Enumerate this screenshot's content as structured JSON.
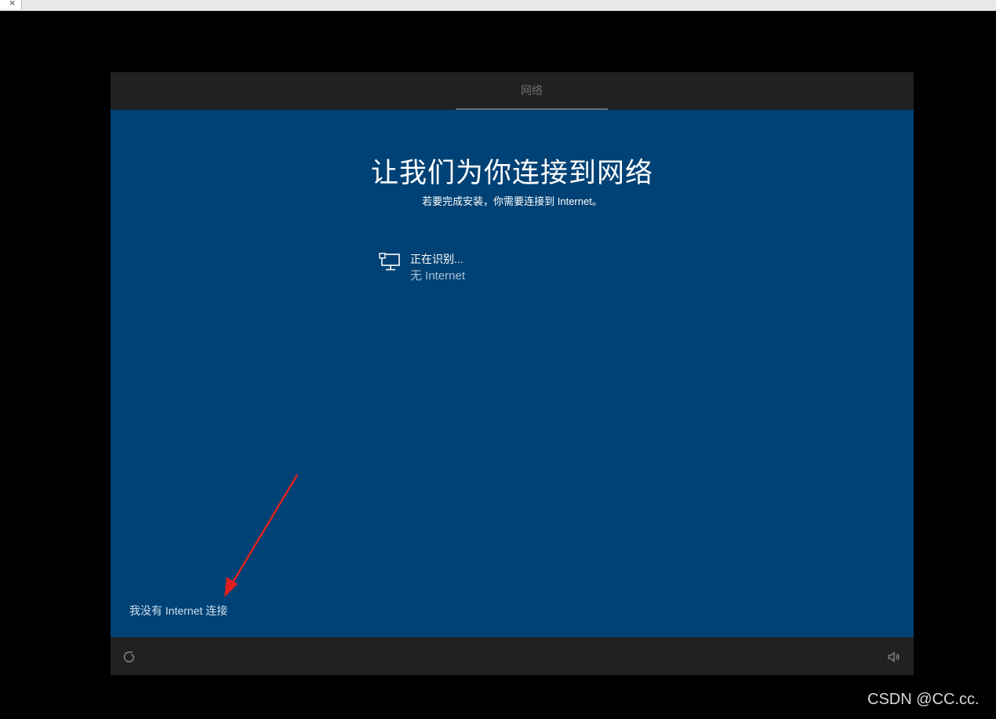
{
  "browser": {
    "close_glyph": "×"
  },
  "setup": {
    "header_tab": "网络",
    "title": "让我们为你连接到网络",
    "subtitle": "若要完成安装，你需要连接到 Internet。",
    "network": {
      "icon": "ethernet-network-icon",
      "name": "正在识别...",
      "status": "无 Internet"
    },
    "skip_link": "我没有 Internet 连接",
    "footer": {
      "left_icon": "ease-of-access-icon",
      "right_icon": "volume-icon"
    }
  },
  "annotation": {
    "arrow_color": "#e02020"
  },
  "watermark": "CSDN @CC.cc.",
  "colors": {
    "background": "#004275",
    "bar": "#212121",
    "outer": "#000000"
  }
}
